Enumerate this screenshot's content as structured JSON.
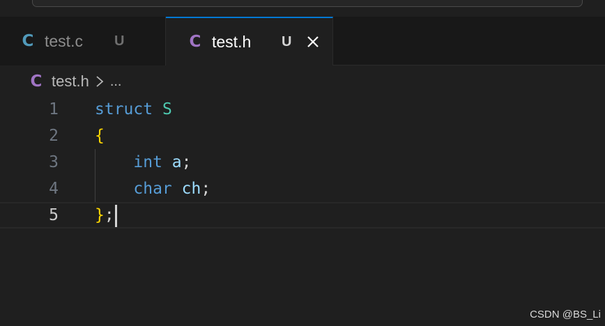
{
  "tabs": [
    {
      "icon": "C",
      "name": "test.c",
      "badge": "U",
      "active": false
    },
    {
      "icon": "C",
      "name": "test.h",
      "badge": "U",
      "active": true
    }
  ],
  "breadcrumb": {
    "icon": "C",
    "file": "test.h",
    "more": "..."
  },
  "editor": {
    "active_line": 5,
    "lines": [
      {
        "number": "1",
        "tokens": [
          "struct",
          " ",
          "S"
        ]
      },
      {
        "number": "2",
        "tokens": [
          "{"
        ]
      },
      {
        "number": "3",
        "tokens": [
          "    ",
          "int",
          " ",
          "a",
          ";"
        ]
      },
      {
        "number": "4",
        "tokens": [
          "    ",
          "char",
          " ",
          "ch",
          ";"
        ]
      },
      {
        "number": "5",
        "tokens": [
          "}",
          ";"
        ]
      }
    ]
  },
  "colors": {
    "keyword": "#569cd6",
    "type_name": "#4ec9b0",
    "brace": "#ffd700",
    "identifier": "#9cdcfe",
    "c_icon_c_file": "#519aba",
    "c_icon_h_file": "#a074c4",
    "active_tab_border": "#0078d4"
  },
  "watermark": "CSDN @BS_Li"
}
